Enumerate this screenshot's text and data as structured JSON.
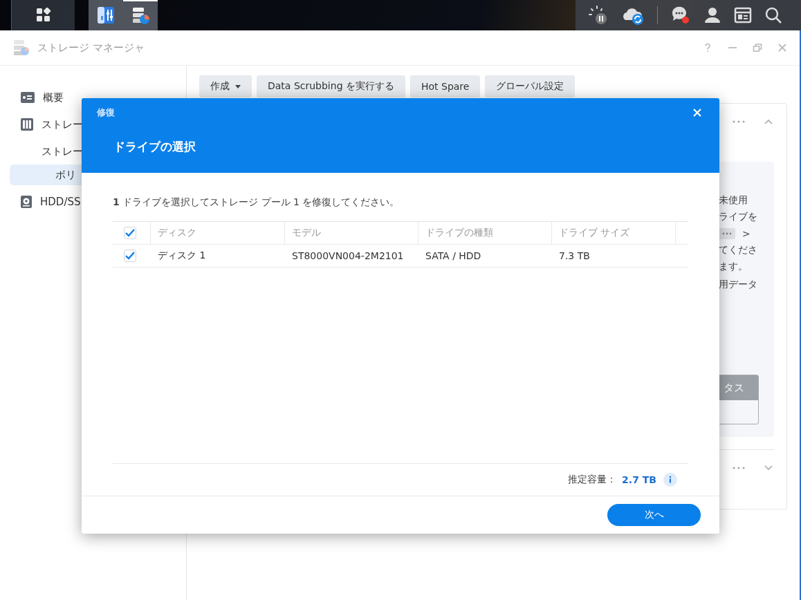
{
  "window": {
    "title": "ストレージ マネージャ"
  },
  "sidebar": {
    "items": [
      {
        "label": "概要",
        "selected": false
      },
      {
        "label": "ストレー",
        "selected": false,
        "children": [
          {
            "label": "ストレー",
            "selected": false
          },
          {
            "label": "ボリ",
            "selected": true
          }
        ]
      },
      {
        "label": "HDD/SS",
        "selected": false
      }
    ]
  },
  "toolbar": {
    "buttons": [
      {
        "label": "作成",
        "dropdown": true
      },
      {
        "label": "Data Scrubbing を実行する",
        "dropdown": false
      },
      {
        "label": "Hot Spare",
        "dropdown": false
      },
      {
        "label": "グローバル設定",
        "dropdown": false
      }
    ]
  },
  "background_panel": {
    "lines": [
      {
        "kind": "text",
        "text": "未使用"
      },
      {
        "kind": "text",
        "text": "ライブを"
      },
      {
        "kind": "more",
        "text": ">"
      },
      {
        "kind": "text",
        "text": "てくださ"
      },
      {
        "kind": "text",
        "text": "ます。"
      }
    ],
    "note": "用データ",
    "status_header": "タス"
  },
  "dialog": {
    "category": "修復",
    "title": "ドライブの選択",
    "instruction": "**1** ドライブを選択してストレージ プール 1 を修復してください。",
    "header_checked": true,
    "columns": [
      "ディスク",
      "モデル",
      "ドライブの種類",
      "ドライブ サイズ"
    ],
    "rows": [
      {
        "checked": true,
        "cells": [
          "ディスク 1",
          "ST8000VN004-2M2101",
          "SATA / HDD",
          "7.3 TB"
        ]
      }
    ],
    "estimate_label": "推定容量：",
    "estimate_value": "2.7 TB",
    "next_button": "次へ"
  }
}
